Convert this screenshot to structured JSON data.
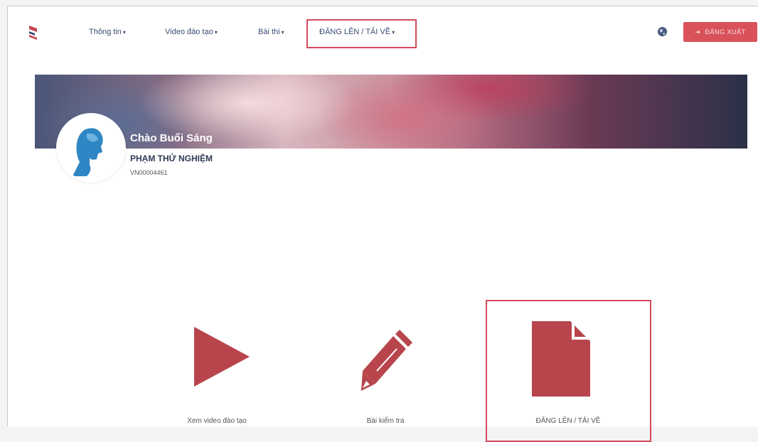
{
  "nav": {
    "items": [
      {
        "label": "Thông tin"
      },
      {
        "label": "Video đào tạo"
      },
      {
        "label": "Bài thi"
      },
      {
        "label": "ĐĂNG LÊN / TẢI VỀ"
      }
    ],
    "logout_label": "ĐĂNG XUẤT"
  },
  "profile": {
    "greeting": "Chào Buổi Sáng",
    "name": "PHẠM THỬ NGHIỆM",
    "id": "VN00004461"
  },
  "tiles": [
    {
      "label": "Xem video đào tạo",
      "icon": "play-icon"
    },
    {
      "label": "Bài kiểm tra",
      "icon": "pencil-icon"
    },
    {
      "label": "ĐĂNG LÊN / TẢI VỀ",
      "icon": "document-icon"
    }
  ],
  "colors": {
    "accent": "#b8454c",
    "nav_text": "#3c4a75",
    "logout_bg": "#d9525a",
    "highlight": "#d24a5c"
  }
}
